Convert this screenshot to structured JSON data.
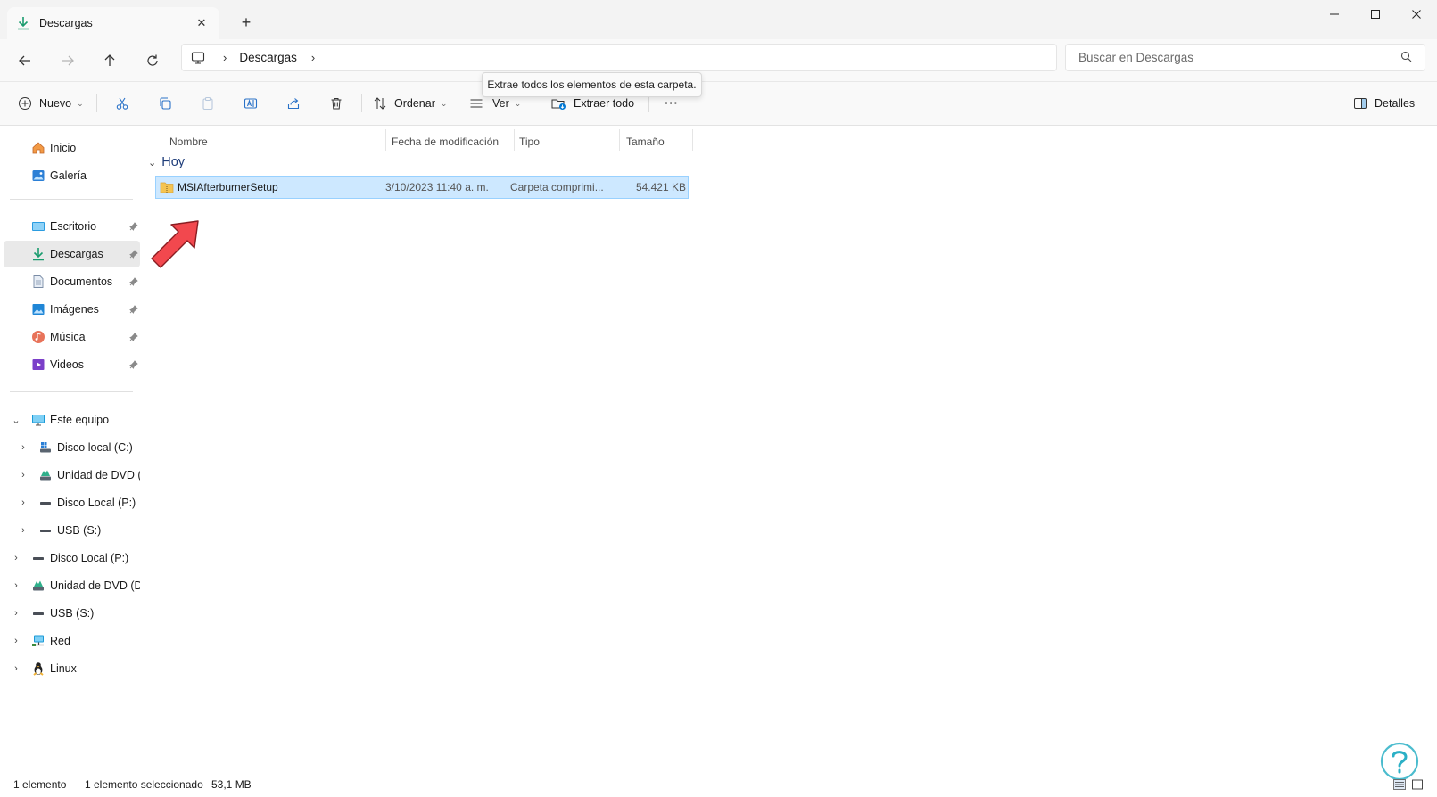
{
  "tab": {
    "title": "Descargas",
    "new_tab_label": "+"
  },
  "window": {
    "minimize": "—",
    "maximize": "☐",
    "close": "✕"
  },
  "address": {
    "crumbs": [
      "Descargas"
    ],
    "separator": "›"
  },
  "search": {
    "placeholder": "Buscar en Descargas"
  },
  "tooltip": {
    "text": "Extrae todos los elementos de esta carpeta."
  },
  "toolbar": {
    "new_label": "Nuevo",
    "sort_label": "Ordenar",
    "view_label": "Ver",
    "extract_label": "Extraer todo",
    "more_label": "···",
    "details_label": "Detalles"
  },
  "sidebar": {
    "quick": [
      {
        "label": "Inicio",
        "icon": "home-icon"
      },
      {
        "label": "Galería",
        "icon": "gallery-icon"
      }
    ],
    "pinned": [
      {
        "label": "Escritorio",
        "icon": "desktop-icon"
      },
      {
        "label": "Descargas",
        "icon": "download-icon"
      },
      {
        "label": "Documentos",
        "icon": "document-icon"
      },
      {
        "label": "Imágenes",
        "icon": "pictures-icon"
      },
      {
        "label": "Música",
        "icon": "music-icon"
      },
      {
        "label": "Videos",
        "icon": "videos-icon"
      }
    ],
    "tree": [
      {
        "label": "Este equipo",
        "icon": "computer-icon"
      },
      {
        "label": "Disco local (C:)",
        "icon": "drive-c-icon"
      },
      {
        "label": "Unidad de DVD (D",
        "icon": "dvd-icon"
      },
      {
        "label": "Disco Local (P:)",
        "icon": "drive-icon"
      },
      {
        "label": "USB (S:)",
        "icon": "usb-icon"
      },
      {
        "label": "Disco Local (P:)",
        "icon": "drive-icon"
      },
      {
        "label": "Unidad de DVD (D:)",
        "icon": "dvd-icon"
      },
      {
        "label": "USB (S:)",
        "icon": "usb-icon"
      },
      {
        "label": "Red",
        "icon": "network-icon"
      },
      {
        "label": "Linux",
        "icon": "linux-icon"
      }
    ]
  },
  "columns": {
    "name": "Nombre",
    "date": "Fecha de modificación",
    "type": "Tipo",
    "size": "Tamaño"
  },
  "group": {
    "label": "Hoy"
  },
  "files": [
    {
      "name": "MSIAfterburnerSetup",
      "date": "3/10/2023 11:40 a. m.",
      "type": "Carpeta comprimi...",
      "size": "54.421 KB"
    }
  ],
  "status": {
    "count": "1 elemento",
    "selected": "1 elemento seleccionado",
    "size": "53,1 MB"
  },
  "colors": {
    "accent": "#0078d4",
    "selection": "#cde8ff",
    "selection_border": "#99d1ff",
    "arrow": "#f2484e"
  }
}
